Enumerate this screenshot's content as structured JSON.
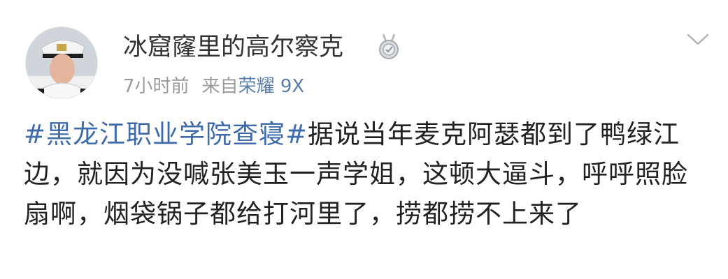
{
  "post": {
    "user_name": "冰窟窿里的高尔察克",
    "time": "7小时前",
    "source_prefix": "来自",
    "source_device": "荣耀 9X",
    "hashtag": "#黑龙江职业学院查寝#",
    "body": "据说当年麦克阿瑟都到了鸭绿江边，就因为没喊张美玉一声学姐，这顿大逼斗，呼呼照脸扇啊，烟袋锅子都给打河里了，捞都捞不上来了"
  },
  "icons": {
    "avatar": "avatar",
    "badge": "medal-badge-icon",
    "menu": "chevron-down-icon"
  },
  "colors": {
    "link": "#3e6aa8",
    "meta": "#9b9b9b",
    "device": "#5b7ea8",
    "text": "#222222"
  }
}
